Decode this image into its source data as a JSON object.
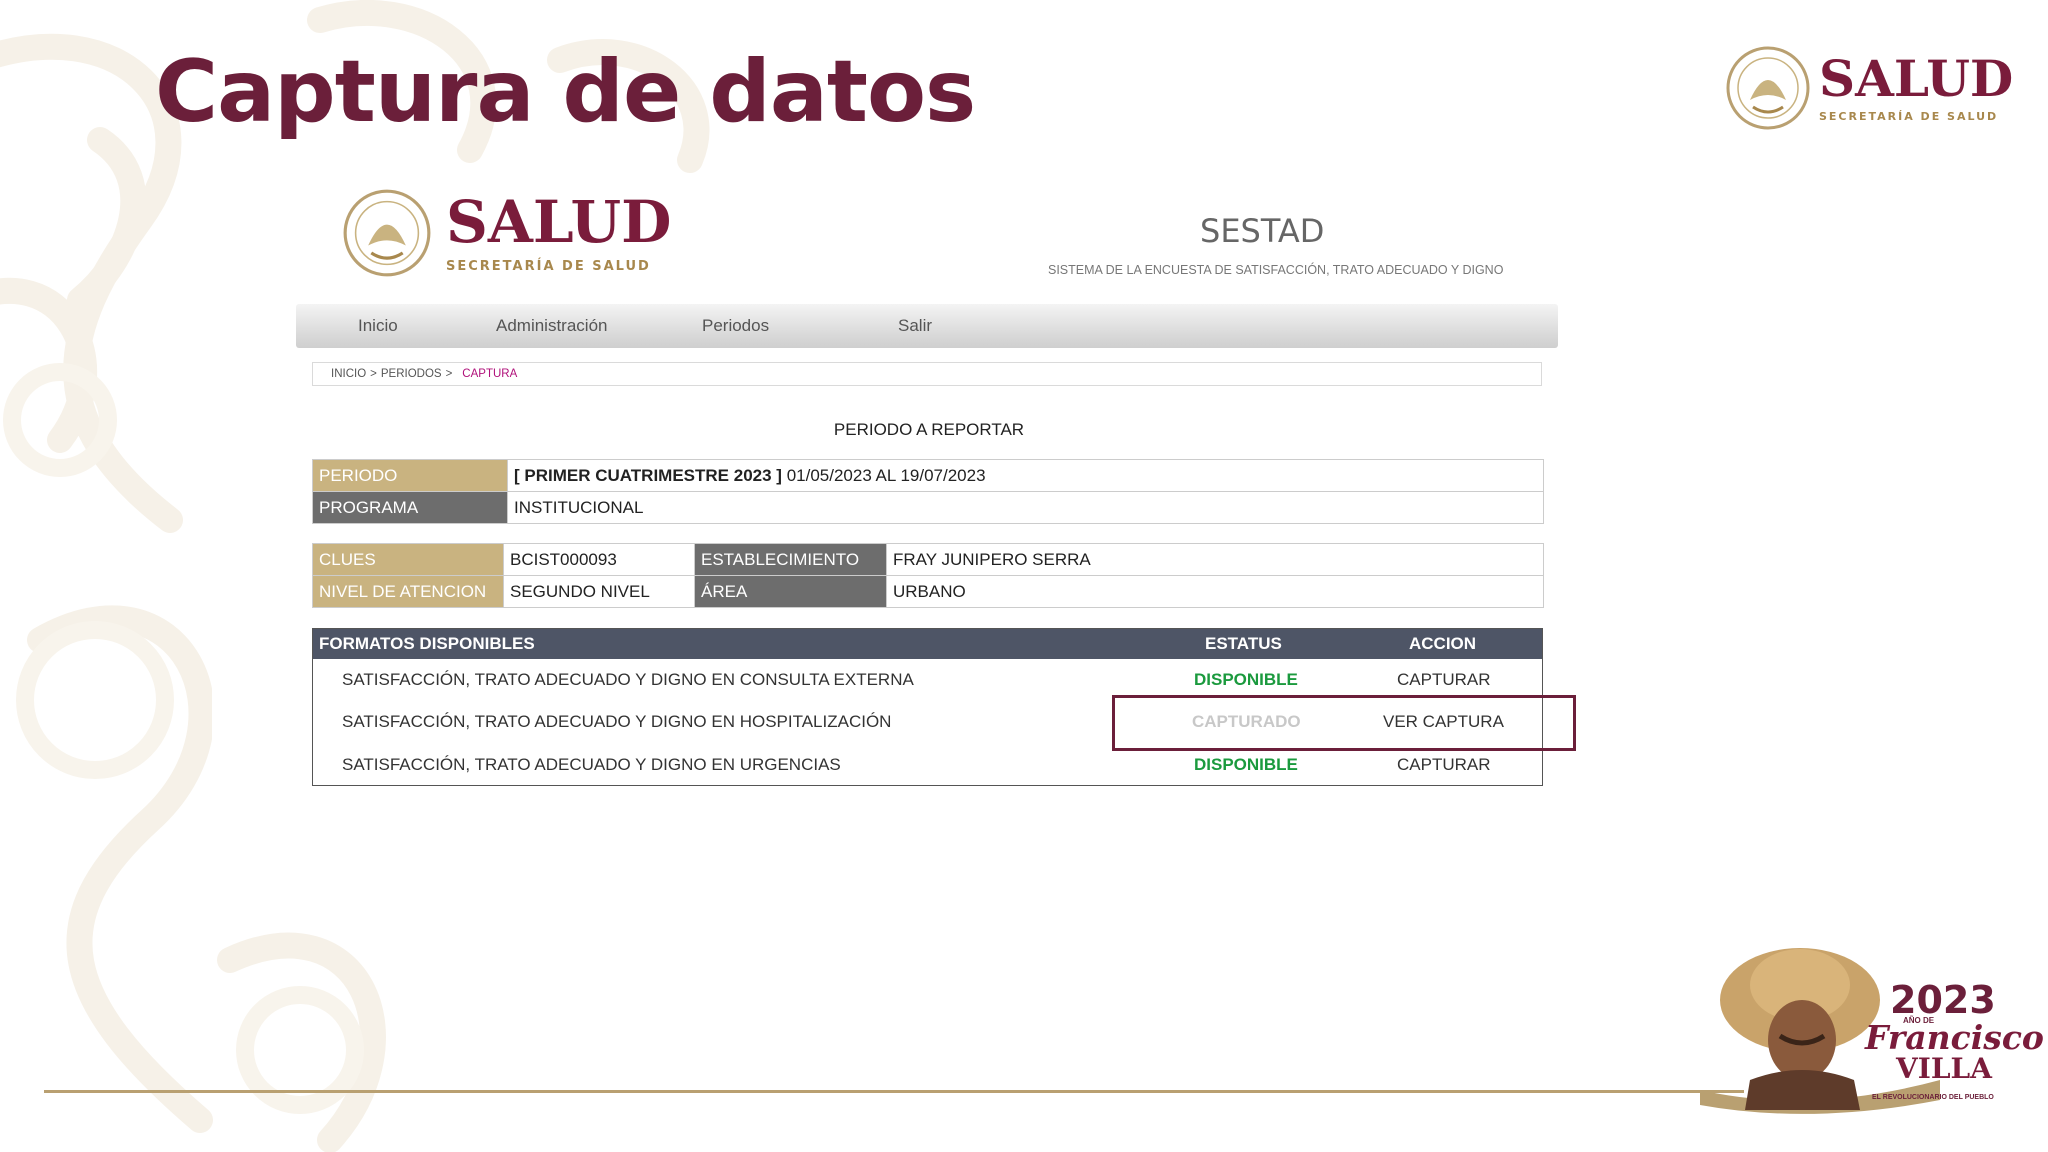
{
  "slide": {
    "title": "Captura de datos"
  },
  "brand_logo": {
    "word": "SALUD",
    "subtitle": "SECRETARÍA DE SALUD"
  },
  "app": {
    "system_name": "SESTAD",
    "system_description": "SISTEMA DE LA ENCUESTA DE SATISFACCIÓN, TRATO ADECUADO Y DIGNO",
    "nav": [
      "Inicio",
      "Administración",
      "Periodos",
      "Salir"
    ],
    "breadcrumb": {
      "inicio": "INICIO",
      "periodos": "PERIODOS",
      "sep": ">",
      "current": "CAPTURA"
    },
    "section_title": "PERIODO A REPORTAR",
    "period": {
      "periodo_label": "PERIODO",
      "periodo_name": "[ PRIMER CUATRIMESTRE 2023 ]",
      "periodo_range": "01/05/2023 AL 19/07/2023",
      "programa_label": "PROGRAMA",
      "programa_value": "INSTITUCIONAL"
    },
    "facility": {
      "clues_label": "CLUES",
      "clues_value": "BCIST000093",
      "establecimiento_label": "ESTABLECIMIENTO",
      "establecimiento_value": "FRAY JUNIPERO SERRA",
      "nivel_label": "NIVEL DE ATENCION",
      "nivel_value": "SEGUNDO NIVEL",
      "area_label": "ÁREA",
      "area_value": "URBANO"
    },
    "formats": {
      "headers": {
        "formatos": "FORMATOS DISPONIBLES",
        "estatus": "ESTATUS",
        "accion": "ACCION"
      },
      "rows": [
        {
          "name": "SATISFACCIÓN, TRATO ADECUADO Y DIGNO EN CONSULTA EXTERNA",
          "status": "DISPONIBLE",
          "action": "CAPTURAR"
        },
        {
          "name": "SATISFACCIÓN, TRATO ADECUADO Y DIGNO EN HOSPITALIZACIÓN",
          "status": "CAPTURADO",
          "action": "VER CAPTURA"
        },
        {
          "name": "SATISFACCIÓN, TRATO ADECUADO Y DIGNO EN URGENCIAS",
          "status": "DISPONIBLE",
          "action": "CAPTURAR"
        }
      ]
    }
  },
  "commemorative_logo": {
    "year": "2023",
    "year_caption": "AÑO DE",
    "first_name": "Francisco",
    "last_name": "VILLA",
    "tagline": "EL REVOLUCIONARIO DEL PUEBLO"
  },
  "colors": {
    "title": "#6b1f3a",
    "brand": "#7a1c3b",
    "gold": "#b9a071",
    "header_band": "#4e5566",
    "status_available": "#1b9a3e",
    "status_captured": "#c8c8c8",
    "highlight_box": "#6b1f3a"
  }
}
